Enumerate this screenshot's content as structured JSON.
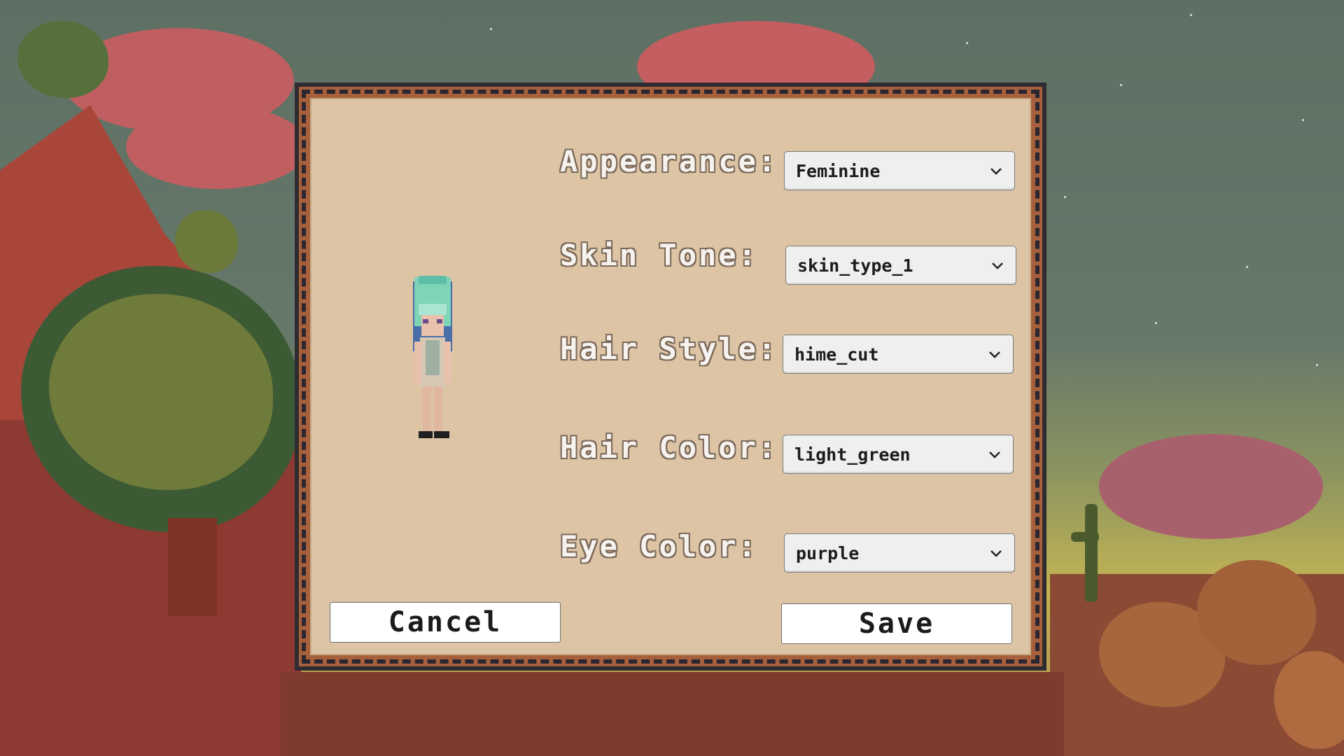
{
  "dialog": {
    "fields": [
      {
        "label": "Appearance:",
        "value": "Feminine"
      },
      {
        "label": "Skin Tone:",
        "value": "skin_type_1"
      },
      {
        "label": "Hair Style:",
        "value": "hime_cut"
      },
      {
        "label": "Hair Color:",
        "value": "light_green"
      },
      {
        "label": "Eye Color:",
        "value": "purple"
      }
    ],
    "cancel_label": "Cancel",
    "save_label": "Save"
  },
  "icons": {
    "dropdown": "chevron-down-icon",
    "character": "character-sprite"
  },
  "colors": {
    "panel": "#dcc4a5",
    "frame": "#a6613c",
    "hair": "#7fd3b7"
  }
}
